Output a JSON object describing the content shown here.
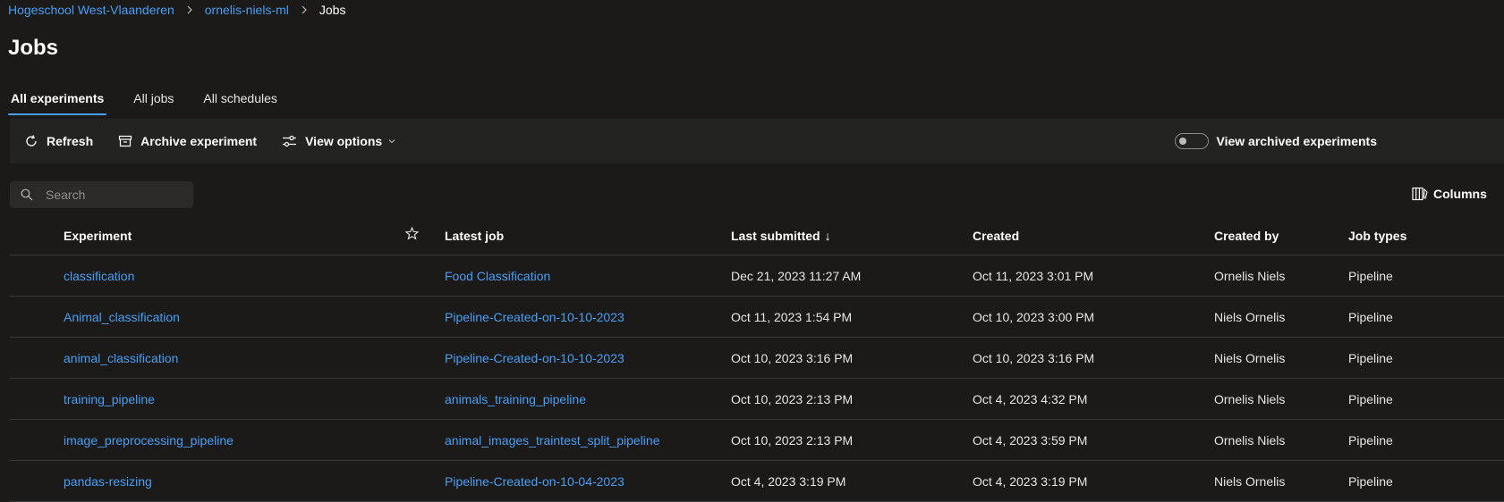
{
  "breadcrumb": {
    "items": [
      "Hogeschool West-Vlaanderen",
      "ornelis-niels-ml"
    ],
    "current": "Jobs"
  },
  "page": {
    "title": "Jobs"
  },
  "tabs": [
    {
      "label": "All experiments",
      "active": true
    },
    {
      "label": "All jobs",
      "active": false
    },
    {
      "label": "All schedules",
      "active": false
    }
  ],
  "toolbar": {
    "refresh": "Refresh",
    "archive": "Archive experiment",
    "view_options": "View options",
    "archived_toggle_label": "View archived experiments",
    "archived_toggle_on": false
  },
  "search": {
    "placeholder": "Search",
    "value": ""
  },
  "columns_button": "Columns",
  "table": {
    "headers": {
      "experiment": "Experiment",
      "latest_job": "Latest job",
      "last_submitted": "Last submitted",
      "created": "Created",
      "created_by": "Created by",
      "job_types": "Job types"
    },
    "sort_indicator": "↓",
    "rows": [
      {
        "experiment": "classification",
        "latest_job": "Food Classification",
        "last_submitted": "Dec 21, 2023 11:27 AM",
        "created": "Oct 11, 2023 3:01 PM",
        "created_by": "Ornelis Niels",
        "job_types": "Pipeline"
      },
      {
        "experiment": "Animal_classification",
        "latest_job": "Pipeline-Created-on-10-10-2023",
        "last_submitted": "Oct 11, 2023 1:54 PM",
        "created": "Oct 10, 2023 3:00 PM",
        "created_by": "Niels Ornelis",
        "job_types": "Pipeline"
      },
      {
        "experiment": "animal_classification",
        "latest_job": "Pipeline-Created-on-10-10-2023",
        "last_submitted": "Oct 10, 2023 3:16 PM",
        "created": "Oct 10, 2023 3:16 PM",
        "created_by": "Niels Ornelis",
        "job_types": "Pipeline"
      },
      {
        "experiment": "training_pipeline",
        "latest_job": "animals_training_pipeline",
        "last_submitted": "Oct 10, 2023 2:13 PM",
        "created": "Oct 4, 2023 4:32 PM",
        "created_by": "Ornelis Niels",
        "job_types": "Pipeline"
      },
      {
        "experiment": "image_preprocessing_pipeline",
        "latest_job": "animal_images_traintest_split_pipeline",
        "last_submitted": "Oct 10, 2023 2:13 PM",
        "created": "Oct 4, 2023 3:59 PM",
        "created_by": "Ornelis Niels",
        "job_types": "Pipeline"
      },
      {
        "experiment": "pandas-resizing",
        "latest_job": "Pipeline-Created-on-10-04-2023",
        "last_submitted": "Oct 4, 2023 3:19 PM",
        "created": "Oct 4, 2023 3:19 PM",
        "created_by": "Niels Ornelis",
        "job_types": "Pipeline"
      }
    ]
  },
  "colors": {
    "background": "#1b1a19",
    "toolbar": "#232322",
    "accent_link": "#479ef5",
    "divider": "#3a3a3a"
  },
  "icons": {
    "breadcrumb_separator": "chevron-right-icon",
    "refresh": "refresh-icon",
    "archive": "archive-icon",
    "view_options": "sliders-icon",
    "dropdown": "chevron-down-icon",
    "search": "search-icon",
    "columns": "columns-icon",
    "favorite": "star-icon",
    "sort": "arrow-down-icon"
  }
}
